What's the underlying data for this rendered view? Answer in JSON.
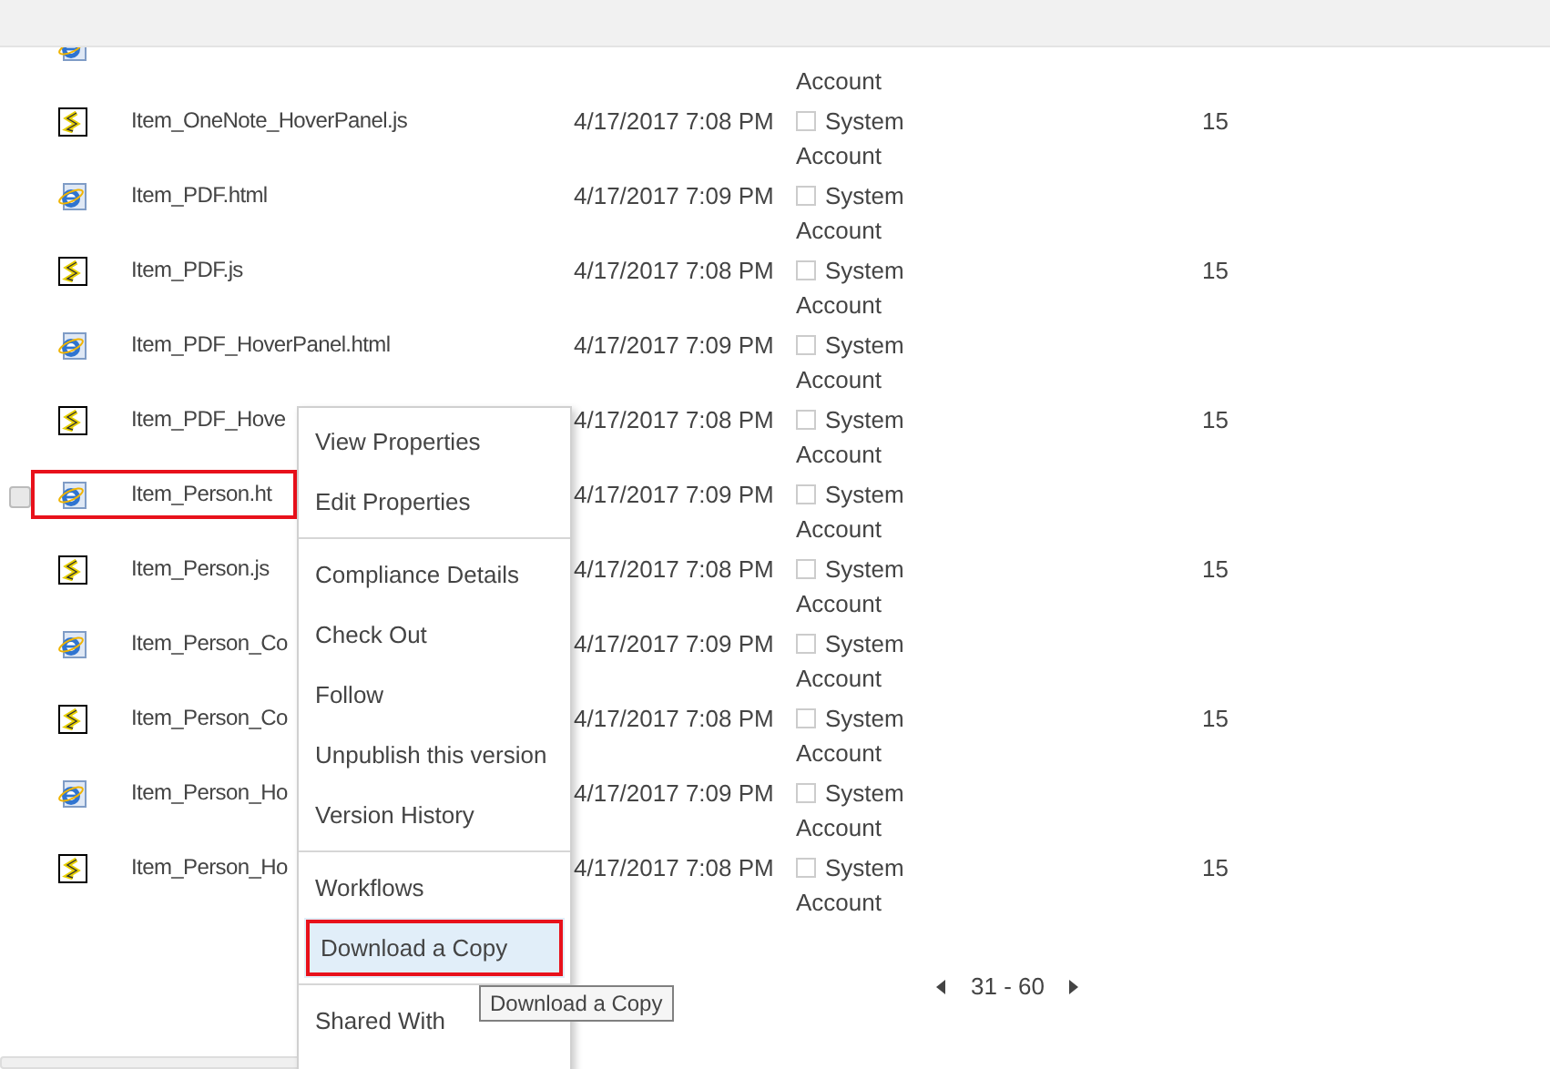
{
  "rows": [
    {
      "kind": "html",
      "modified_by": "Account",
      "selected": false,
      "highlighted": false
    },
    {
      "kind": "js",
      "name": "Item_OneNote_HoverPanel.js",
      "modified": "4/17/2017 7:08 PM",
      "modified_by": "System Account",
      "count": "15",
      "selected": false,
      "highlighted": false
    },
    {
      "kind": "html",
      "name": "Item_PDF.html",
      "modified": "4/17/2017 7:09 PM",
      "modified_by": "System Account",
      "selected": false,
      "highlighted": false
    },
    {
      "kind": "js",
      "name": "Item_PDF.js",
      "modified": "4/17/2017 7:08 PM",
      "modified_by": "System Account",
      "count": "15",
      "selected": false,
      "highlighted": false
    },
    {
      "kind": "html",
      "name": "Item_PDF_HoverPanel.html",
      "modified": "4/17/2017 7:09 PM",
      "modified_by": "System Account",
      "selected": false,
      "highlighted": false
    },
    {
      "kind": "js",
      "name": "Item_PDF_Hove",
      "modified": "4/17/2017 7:08 PM",
      "modified_by": "System Account",
      "count": "15",
      "selected": false,
      "highlighted": false
    },
    {
      "kind": "html",
      "name": "Item_Person.ht",
      "modified": "4/17/2017 7:09 PM",
      "modified_by": "System Account",
      "selected": true,
      "highlighted": true
    },
    {
      "kind": "js",
      "name": "Item_Person.js",
      "modified": "4/17/2017 7:08 PM",
      "modified_by": "System Account",
      "count": "15",
      "selected": false,
      "highlighted": false
    },
    {
      "kind": "html",
      "name": "Item_Person_Co",
      "modified": "4/17/2017 7:09 PM",
      "modified_by": "System Account",
      "selected": false,
      "highlighted": false
    },
    {
      "kind": "js",
      "name": "Item_Person_Co",
      "modified": "4/17/2017 7:08 PM",
      "modified_by": "System Account",
      "count": "15",
      "selected": false,
      "highlighted": false
    },
    {
      "kind": "html",
      "name": "Item_Person_Ho",
      "modified": "4/17/2017 7:09 PM",
      "modified_by": "System Account",
      "selected": false,
      "highlighted": false
    },
    {
      "kind": "js",
      "name": "Item_Person_Ho",
      "modified": "4/17/2017 7:08 PM",
      "modified_by": "System Account",
      "count": "15",
      "selected": false,
      "highlighted": false
    }
  ],
  "pager": {
    "range": "31 - 60"
  },
  "context_menu": {
    "groups": [
      [
        {
          "label": "View Properties",
          "selected": false,
          "highlighted": false
        },
        {
          "label": "Edit Properties",
          "selected": false,
          "highlighted": false
        }
      ],
      [
        {
          "label": "Compliance Details",
          "selected": false,
          "highlighted": false
        },
        {
          "label": "Check Out",
          "selected": false,
          "highlighted": false
        },
        {
          "label": "Follow",
          "selected": false,
          "highlighted": false
        },
        {
          "label": "Unpublish this version",
          "selected": false,
          "highlighted": false
        },
        {
          "label": "Version History",
          "selected": false,
          "highlighted": false
        }
      ],
      [
        {
          "label": "Workflows",
          "selected": false,
          "highlighted": false
        },
        {
          "label": "Download a Copy",
          "selected": true,
          "highlighted": true
        }
      ],
      [
        {
          "label": "Shared With",
          "selected": false,
          "highlighted": false
        }
      ]
    ]
  },
  "tooltip": {
    "text": "Download a Copy"
  }
}
